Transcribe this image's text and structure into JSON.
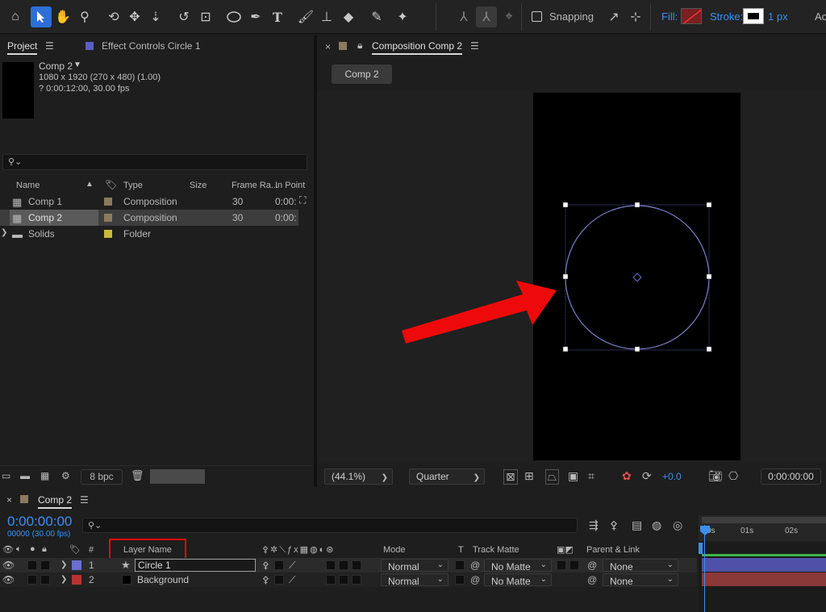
{
  "toolbar": {
    "snapping_label": "Snapping",
    "fill_label": "Fill:",
    "stroke_label": "Stroke:",
    "stroke_width": "1 px",
    "overflow_label": "Ac",
    "icons": [
      "home-icon",
      "selection-tool-icon",
      "hand-tool-icon",
      "zoom-tool-icon",
      "orbit-camera-icon",
      "pan-camera-icon",
      "dolly-camera-icon",
      "rotate-tool-icon",
      "anchor-point-tool-icon",
      "ellipse-tool-icon",
      "pen-tool-icon",
      "type-tool-icon",
      "brush-tool-icon",
      "clone-stamp-icon",
      "eraser-icon",
      "roto-brush-icon",
      "puppet-pin-icon"
    ],
    "accent_color": "#2d6fd6"
  },
  "project_panel": {
    "tab_label": "Project",
    "effect_controls_label": "Effect Controls Circle 1",
    "comp_name": "Comp 2",
    "comp_size": "1080 x 1920  (270 x 480) (1.00)",
    "comp_duration": "? 0:00:12:00, 30.00 fps",
    "search_placeholder": "",
    "columns": [
      "Name",
      "Type",
      "Size",
      "Frame Ra...",
      "In Point"
    ],
    "items": [
      {
        "name": "Comp 1",
        "type": "Composition",
        "size": "",
        "frame_rate": "30",
        "in_point": "0:00:",
        "swatch": "#8b7a5e"
      },
      {
        "name": "Comp 2",
        "type": "Composition",
        "size": "",
        "frame_rate": "30",
        "in_point": "0:00:",
        "swatch": "#8b7a5e"
      },
      {
        "name": "Solids",
        "type": "Folder",
        "size": "",
        "frame_rate": "",
        "in_point": "",
        "swatch": "#c8b83a"
      }
    ],
    "bit_depth": "8 bpc"
  },
  "comp_panel": {
    "tab_label": "Composition Comp 2",
    "flow_tab": "Comp 2",
    "zoom": "(44.1%)",
    "resolution": "Quarter",
    "exposure": "+0.0",
    "timecode": "0:00:00:00"
  },
  "timeline": {
    "tab_label": "Comp 2",
    "current_time": "0:00:00:00",
    "frame_info": "00000 (30.00 fps)",
    "headers": {
      "num": "#",
      "layer_name": "Layer Name",
      "mode": "Mode",
      "t": "T",
      "track_matte": "Track Matte",
      "parent_link": "Parent & Link"
    },
    "ruler": [
      "0s",
      "01s",
      "02s"
    ],
    "layers": [
      {
        "num": "1",
        "name": "Circle 1",
        "mode": "Normal",
        "matte": "No Matte",
        "parent": "None",
        "label_color": "#6a6fd0",
        "bar_color": "#4f51a8"
      },
      {
        "num": "2",
        "name": "Background",
        "mode": "Normal",
        "matte": "No Matte",
        "parent": "None",
        "label_color": "#b83232",
        "bar_color": "#8a3838"
      }
    ]
  }
}
